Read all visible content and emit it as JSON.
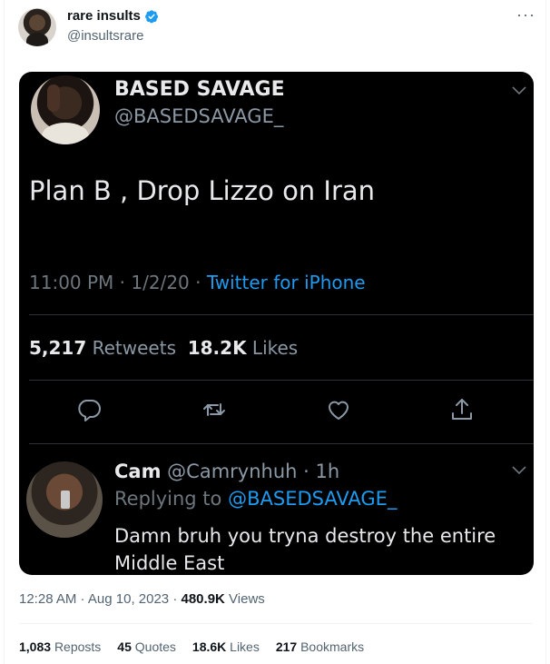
{
  "author": {
    "name": "rare insults",
    "handle": "@insultsrare",
    "verified_color": "#1d9bf0"
  },
  "more_label": "···",
  "embedded_tweet": {
    "name": "BASED SAVAGE",
    "handle": "@BASEDSAVAGE_",
    "text": "Plan B , Drop Lizzo on Iran",
    "time": "11:00 PM",
    "date": "1/2/20",
    "source": "Twitter for iPhone",
    "retweets_count": "5,217",
    "retweets_label": "Retweets",
    "likes_count": "18.2K",
    "likes_label": "Likes",
    "actions": [
      "reply-icon",
      "retweet-icon",
      "like-icon",
      "share-icon"
    ]
  },
  "embedded_reply": {
    "name": "Cam",
    "handle": "@Camrynhuh",
    "age": "1h",
    "replying_prefix": "Replying to",
    "replying_to": "@BASEDSAVAGE_",
    "text": "Damn bruh you tryna destroy the entire Middle East"
  },
  "footer": {
    "time": "12:28 AM",
    "date": "Aug 10, 2023",
    "views_count": "480.9K",
    "views_label": "Views",
    "reposts_count": "1,083",
    "reposts_label": "Reposts",
    "quotes_count": "45",
    "quotes_label": "Quotes",
    "likes_count": "18.6K",
    "likes_label": "Likes",
    "bookmarks_count": "217",
    "bookmarks_label": "Bookmarks"
  }
}
